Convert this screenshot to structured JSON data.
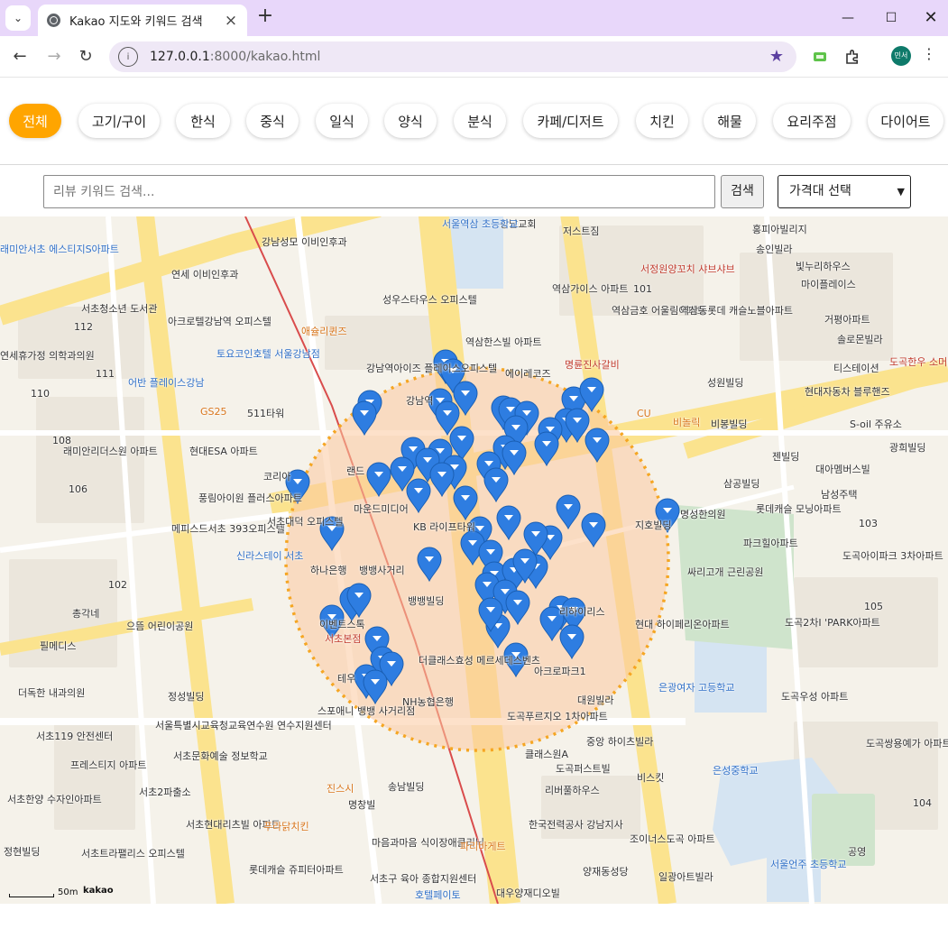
{
  "browser": {
    "tab_title": "Kakao 지도와 키워드 검색",
    "url_host": "127.0.0.1",
    "url_rest": ":8000/kakao.html",
    "profile_label": "민서",
    "window_controls": [
      "minimize-icon",
      "maximize-icon",
      "close-icon"
    ]
  },
  "categories": [
    {
      "label": "전체",
      "active": true
    },
    {
      "label": "고기/구이",
      "active": false
    },
    {
      "label": "한식",
      "active": false
    },
    {
      "label": "중식",
      "active": false
    },
    {
      "label": "일식",
      "active": false
    },
    {
      "label": "양식",
      "active": false
    },
    {
      "label": "분식",
      "active": false
    },
    {
      "label": "카페/디저트",
      "active": false
    },
    {
      "label": "치킨",
      "active": false
    },
    {
      "label": "해물",
      "active": false
    },
    {
      "label": "요리주점",
      "active": false
    },
    {
      "label": "다이어트",
      "active": false
    }
  ],
  "search": {
    "placeholder": "리뷰 키워드 검색...",
    "value": "",
    "button_label": "검색",
    "price_select": "가격대 선택"
  },
  "map": {
    "scale_label": "50m",
    "logo": "kakao",
    "accent_color": "#ffa500",
    "marker_color": "#2e7de1",
    "circle_fill": "#fbd1ae",
    "labels": [
      "강남교회",
      "저스트짐",
      "서울역삼 초등학교",
      "홍피아빌리지",
      "송인빌라",
      "빛누리하우스",
      "마이플레이스",
      "강남성모 이비인후과",
      "연세 이비인후과",
      "성우스타우스 오피스텔",
      "아크로텔강남역 오피스텔",
      "애슐리퀸즈",
      "토요코인호텔 서울강남점",
      "강남역아이즈 플레이스오피스텔",
      "역삼한스빌 아파트",
      "역삼가이스 아파트",
      "서정원양꼬치 샤브샤브",
      "역삼금호 어울림아파트",
      "역삼동롯데 캐슬노블아파트",
      "거평아파트",
      "솔로몬빌라",
      "명륜진사갈비",
      "에이레코즈",
      "티스테이션",
      "도곡한우 소머리국밥",
      "성원빌딩",
      "현대자동차 블루핸즈",
      "CU",
      "비놀릭",
      "비봉빌딩",
      "S-oil 주유소",
      "광희빌딩",
      "GS25",
      "511타워",
      "현대ESA 아파트",
      "래미안리더스원 아파트",
      "코리아",
      "랜드",
      "마운드미디어",
      "KB 라이프타워",
      "풍림아이원 플러스아파트",
      "메피스드서초 393오피스텔",
      "서초대덕 오피스텔",
      "신라스테이 서초",
      "하나은행",
      "뱅뱅사거리",
      "뱅뱅빌딩",
      "이벤트스톡",
      "서초본점",
      "테우",
      "더클래스효성 메르세데스벤츠",
      "NH농협은행",
      "스포애니 뱅뱅 사거리점",
      "도곡푸르지오 1차아파트",
      "아크로파크1",
      "대원빌라",
      "리하이리스",
      "현대 하이페리온아파트",
      "은광여자 고등학교",
      "은성중학교",
      "클래스원A",
      "중앙 하이츠빌라",
      "도곡퍼스트빌",
      "비스킷",
      "리버풀하우스",
      "서울특별시교육청교육연수원 연수지원센터",
      "서초문화예술 정보학교",
      "서초2파출소",
      "서초119 안전센터",
      "프레스티지 아파트",
      "서초한양 수자인아파트",
      "서초현대리츠빌 아파트",
      "푸라닭치킨",
      "진스시",
      "명창빌",
      "송남빌딩",
      "마음과마음 식이장애클리닉",
      "한국전력공사 강남지사",
      "조이너스도곡 아파트",
      "파리바게트",
      "서초구 육아 종합지원센터",
      "롯데캐슬 쥬피터아파트",
      "양재동성당",
      "일광아트빌라",
      "서울언주 초등학교",
      "공영",
      "호텔페이토",
      "대우양재디오빌",
      "서초트라팰리스 오피스텔",
      "정현빌딩",
      "103",
      "104",
      "105",
      "101",
      "102",
      "106",
      "108",
      "110",
      "111",
      "112",
      "도곡아이파크 3차아파트",
      "도곡2차I 'PARK아파트",
      "도곡우성 아파트",
      "도곡쌍용예가 아파트",
      "남성주택",
      "롯데캐슬 모닝아파트",
      "파크힐아파트",
      "싸리고개 근린공원",
      "대아멤버스빌",
      "삼공빌딩",
      "젠빌딩",
      "명성한의원",
      "지호빌딩",
      "총각네",
      "으뜸 어린이공원",
      "필메디스",
      "더독한 내과의원",
      "정성빌딩",
      "서초청소년 도서관",
      "어반 플레이스강남",
      "연세휴가정 의학과의원",
      "래미안서초 에스티지S아파트",
      "강남역"
    ]
  }
}
